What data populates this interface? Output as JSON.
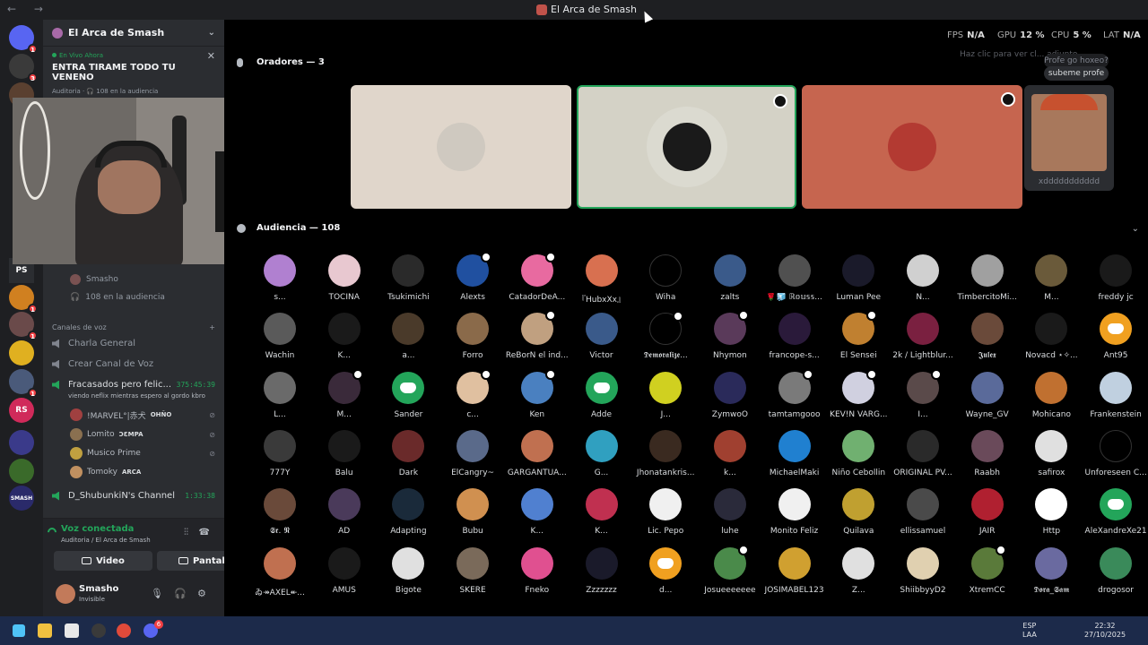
{
  "window": {
    "title": "El Arca de Smash",
    "nav": "← →"
  },
  "hud": {
    "fps_label": "FPS",
    "fps": "N/A",
    "gpu_label": "GPU",
    "gpu": "12 %",
    "cpu_label": "CPU",
    "cpu": "5 %",
    "lat_label": "LAT",
    "lat": "N/A"
  },
  "rail": {
    "items": [
      {
        "label": "",
        "color": "#5865f2",
        "badge": "1"
      },
      {
        "label": "",
        "color": "#3a3a3a",
        "badge": "3"
      },
      {
        "label": "",
        "color": "#5a4030",
        "badge": ""
      },
      {
        "label": "PS",
        "color": "#2b2d31",
        "badge": ""
      },
      {
        "label": "",
        "color": "#d08020",
        "badge": "1"
      },
      {
        "label": "",
        "color": "#6a4a4a",
        "badge": "1"
      },
      {
        "label": "",
        "color": "#e0b020",
        "badge": ""
      },
      {
        "label": "",
        "color": "#4a5a7a",
        "badge": "1"
      },
      {
        "label": "RS",
        "color": "#d02a5a",
        "badge": ""
      },
      {
        "label": "",
        "color": "#3a3a8a",
        "badge": ""
      },
      {
        "label": "",
        "color": "#3a6a2a",
        "badge": ""
      },
      {
        "label": "SMASH",
        "color": "#2a2a6a",
        "badge": ""
      }
    ]
  },
  "sidebar": {
    "server_name": "El Arca de Smash",
    "live_label": "En Vivo Ahora",
    "live_title": "ENTRA TIRAME TODO TU VENENO",
    "live_meta": "Auditoria · 🎧 108 en la audiencia",
    "stage_users": [
      {
        "name": "Smasho"
      },
      {
        "name": "108 en la audiencia"
      }
    ],
    "voice_section": "Canales de voz",
    "channels": [
      {
        "name": "Charla General",
        "time": ""
      },
      {
        "name": "Crear Canal de Voz",
        "time": ""
      },
      {
        "name": "Fracasados pero felic...",
        "time": "375:45:39"
      }
    ],
    "channel_status": "viendo neflix mientras espero al gordo kbro",
    "members": [
      {
        "name": "!MARVEL°|赤犬",
        "tag": "OHÑO",
        "color": "#a04040"
      },
      {
        "name": "Lomito",
        "tag": "ƆƐMPA",
        "color": "#8a7050"
      },
      {
        "name": "Musico Prime",
        "tag": "",
        "color": "#c0a040"
      },
      {
        "name": "Tomoky",
        "tag": "ARCA",
        "color": "#c09060"
      }
    ],
    "channel4": {
      "name": "D_ShubunkiN's Channel",
      "time": "1:33:38"
    },
    "voice_connected": "Voz conectada",
    "voice_location": "Auditoria / El Arca de Smash",
    "video_btn": "Video",
    "screen_btn": "Pantalla",
    "user_name": "Smasho",
    "user_status": "Invisible"
  },
  "stage": {
    "speakers_title": "Oradores — 3",
    "audience_title": "Audiencia — 108",
    "speakers": [
      {
        "bg": "#e0d6cb",
        "av": "#cfc9c0",
        "mod": false
      },
      {
        "bg": "#d4d2c6",
        "av": "#1a1a1a",
        "mod": true
      },
      {
        "bg": "#c6654f",
        "av": "#b33a32",
        "mod": true
      }
    ],
    "side_name": "xddddddddddd",
    "chat_hint": "Haz clic para ver cl... adjunto",
    "chat_bubble": "subeme profe",
    "chat_prev": "Profe go hoxeo?"
  },
  "audience": [
    {
      "name": "s...",
      "c": "#b080d0"
    },
    {
      "name": "TOCINA",
      "c": "#e8c8d0"
    },
    {
      "name": "Tsukimichi",
      "c": "#2a2a2a"
    },
    {
      "name": "Alexts",
      "c": "#2050a0",
      "mod": true
    },
    {
      "name": "CatadorDeA...",
      "c": "#e86aa0",
      "mod": true
    },
    {
      "name": "『HubxXx』",
      "c": "#d87050"
    },
    {
      "name": "Wiha",
      "c": "#000"
    },
    {
      "name": "zalts",
      "c": "#3a5a8a"
    },
    {
      "name": "🌹🧊 ℝ𝕠𝕦𝕤𝕤...",
      "c": "#505050"
    },
    {
      "name": "Luman Pee",
      "c": "#1a1a2a"
    },
    {
      "name": "N...",
      "c": "#d0d0d0"
    },
    {
      "name": "TimbercitoMi...",
      "c": "#a0a0a0"
    },
    {
      "name": "M...",
      "c": "#6a5a3a"
    },
    {
      "name": "freddy jc",
      "c": "#1a1a1a"
    },
    {
      "name": "Wachin",
      "c": "#5a5a5a"
    },
    {
      "name": "K...",
      "c": "#1a1a1a"
    },
    {
      "name": "a...",
      "c": "#4a3a2a"
    },
    {
      "name": "Forro",
      "c": "#8a6a4a"
    },
    {
      "name": "ReBorN el ind...",
      "c": "#c0a080",
      "mod": true
    },
    {
      "name": "Victor",
      "c": "#3a5a8a"
    },
    {
      "name": "𝕯𝖊𝖒𝖔𝖗𝖆𝖑𝖎𝖟𝖊...",
      "c": "#000",
      "mod": true
    },
    {
      "name": "Nhymon",
      "c": "#5a3a5a",
      "mod": true
    },
    {
      "name": "francope-s...",
      "c": "#2a1a3a"
    },
    {
      "name": "El Sensei",
      "c": "#c08030",
      "mod": true
    },
    {
      "name": "2k / Lightblur...",
      "c": "#7a2040"
    },
    {
      "name": "𝕵𝖚𝖑𝖊𝖝",
      "c": "#6a4a3a"
    },
    {
      "name": "Novacd ⋆✧...",
      "c": "#1a1a1a"
    },
    {
      "name": "Ant95",
      "c": "#f0a020",
      "dc": true
    },
    {
      "name": "L...",
      "c": "#6a6a6a"
    },
    {
      "name": "M...",
      "c": "#3a2a3a",
      "mod": true
    },
    {
      "name": "Sander",
      "c": "#23a55a",
      "dc": true
    },
    {
      "name": "c...",
      "c": "#e0c0a0",
      "mod": true
    },
    {
      "name": "Ken",
      "c": "#4a80c0",
      "mod": true
    },
    {
      "name": "Adde",
      "c": "#23a55a",
      "dc": true
    },
    {
      "name": "J...",
      "c": "#d0d020"
    },
    {
      "name": "ZymwoO",
      "c": "#2a2a5a"
    },
    {
      "name": "tamtamgooo",
      "c": "#7a7a7a",
      "mod": true
    },
    {
      "name": "KEV!N VARG...",
      "c": "#d0d0e0",
      "mod": true
    },
    {
      "name": "I...",
      "c": "#5a4a4a",
      "mod": true
    },
    {
      "name": "Wayne_GV",
      "c": "#5a6a9a"
    },
    {
      "name": "Mohicano",
      "c": "#c07030"
    },
    {
      "name": "Frankenstein",
      "c": "#c0d0e0"
    },
    {
      "name": "777Y",
      "c": "#3a3a3a"
    },
    {
      "name": "Balu",
      "c": "#1a1a1a"
    },
    {
      "name": "Dark",
      "c": "#6a2a2a"
    },
    {
      "name": "ElCangry~",
      "c": "#5a6a8a"
    },
    {
      "name": "GARGANTUA...",
      "c": "#c07050"
    },
    {
      "name": "G...",
      "c": "#30a0c0"
    },
    {
      "name": "Jhonatankris...",
      "c": "#3a2a20"
    },
    {
      "name": "k...",
      "c": "#a04030"
    },
    {
      "name": "MichaelMaki",
      "c": "#2080d0"
    },
    {
      "name": "Niño Cebollin",
      "c": "#70b070"
    },
    {
      "name": "ORIGINAL PV...",
      "c": "#2a2a2a"
    },
    {
      "name": "Raabh",
      "c": "#6a4a5a"
    },
    {
      "name": "safirox",
      "c": "#e0e0e0"
    },
    {
      "name": "Unforeseen C...",
      "c": "#000"
    },
    {
      "name": "𝕾𝖗. 𝕹",
      "c": "#6a4a3a"
    },
    {
      "name": "AD",
      "c": "#4a3a5a"
    },
    {
      "name": "Adapting",
      "c": "#1a2a3a"
    },
    {
      "name": "Bubu",
      "c": "#d09050"
    },
    {
      "name": "K...",
      "c": "#5080d0"
    },
    {
      "name": "K...",
      "c": "#c03050"
    },
    {
      "name": "Lic. Pepo",
      "c": "#f0f0f0"
    },
    {
      "name": "luhe",
      "c": "#2a2a3a"
    },
    {
      "name": "Monito Feliz",
      "c": "#f0f0f0"
    },
    {
      "name": "Quilava",
      "c": "#c0a030"
    },
    {
      "name": "ellissamuel",
      "c": "#4a4a4a"
    },
    {
      "name": "JAIR",
      "c": "#b02030"
    },
    {
      "name": "Http",
      "c": "#fff"
    },
    {
      "name": "AleXandreXe21",
      "c": "#23a55a",
      "dc": true
    },
    {
      "name": "ゐ↠AXEL↞...",
      "c": "#c07050"
    },
    {
      "name": "AMUS",
      "c": "#1a1a1a"
    },
    {
      "name": "Bigote",
      "c": "#e0e0e0"
    },
    {
      "name": "SKERE",
      "c": "#7a6a5a"
    },
    {
      "name": "Fneko",
      "c": "#e05090"
    },
    {
      "name": "Zzzzzzz",
      "c": "#1a1a2a"
    },
    {
      "name": "d...",
      "c": "#f0a020",
      "dc": true
    },
    {
      "name": "Josueeeeeee",
      "c": "#4a8a4a",
      "mod": true
    },
    {
      "name": "JOSIMABEL123",
      "c": "#d0a030"
    },
    {
      "name": "Z...",
      "c": "#e0e0e0"
    },
    {
      "name": "ShiibbyyD2",
      "c": "#e0d0b0"
    },
    {
      "name": "XtremCC",
      "c": "#5a7a3a",
      "mod": true
    },
    {
      "name": "𝕯𝖔𝖗𝖆_𝕾𝖆𝖒",
      "c": "#6a6aa0"
    },
    {
      "name": "drogosor",
      "c": "#3a8a5a"
    }
  ],
  "taskbar": {
    "lang": "ESP",
    "lang2": "LAA",
    "time": "22:32",
    "date": "27/10/2025",
    "discord_badge": "6"
  }
}
